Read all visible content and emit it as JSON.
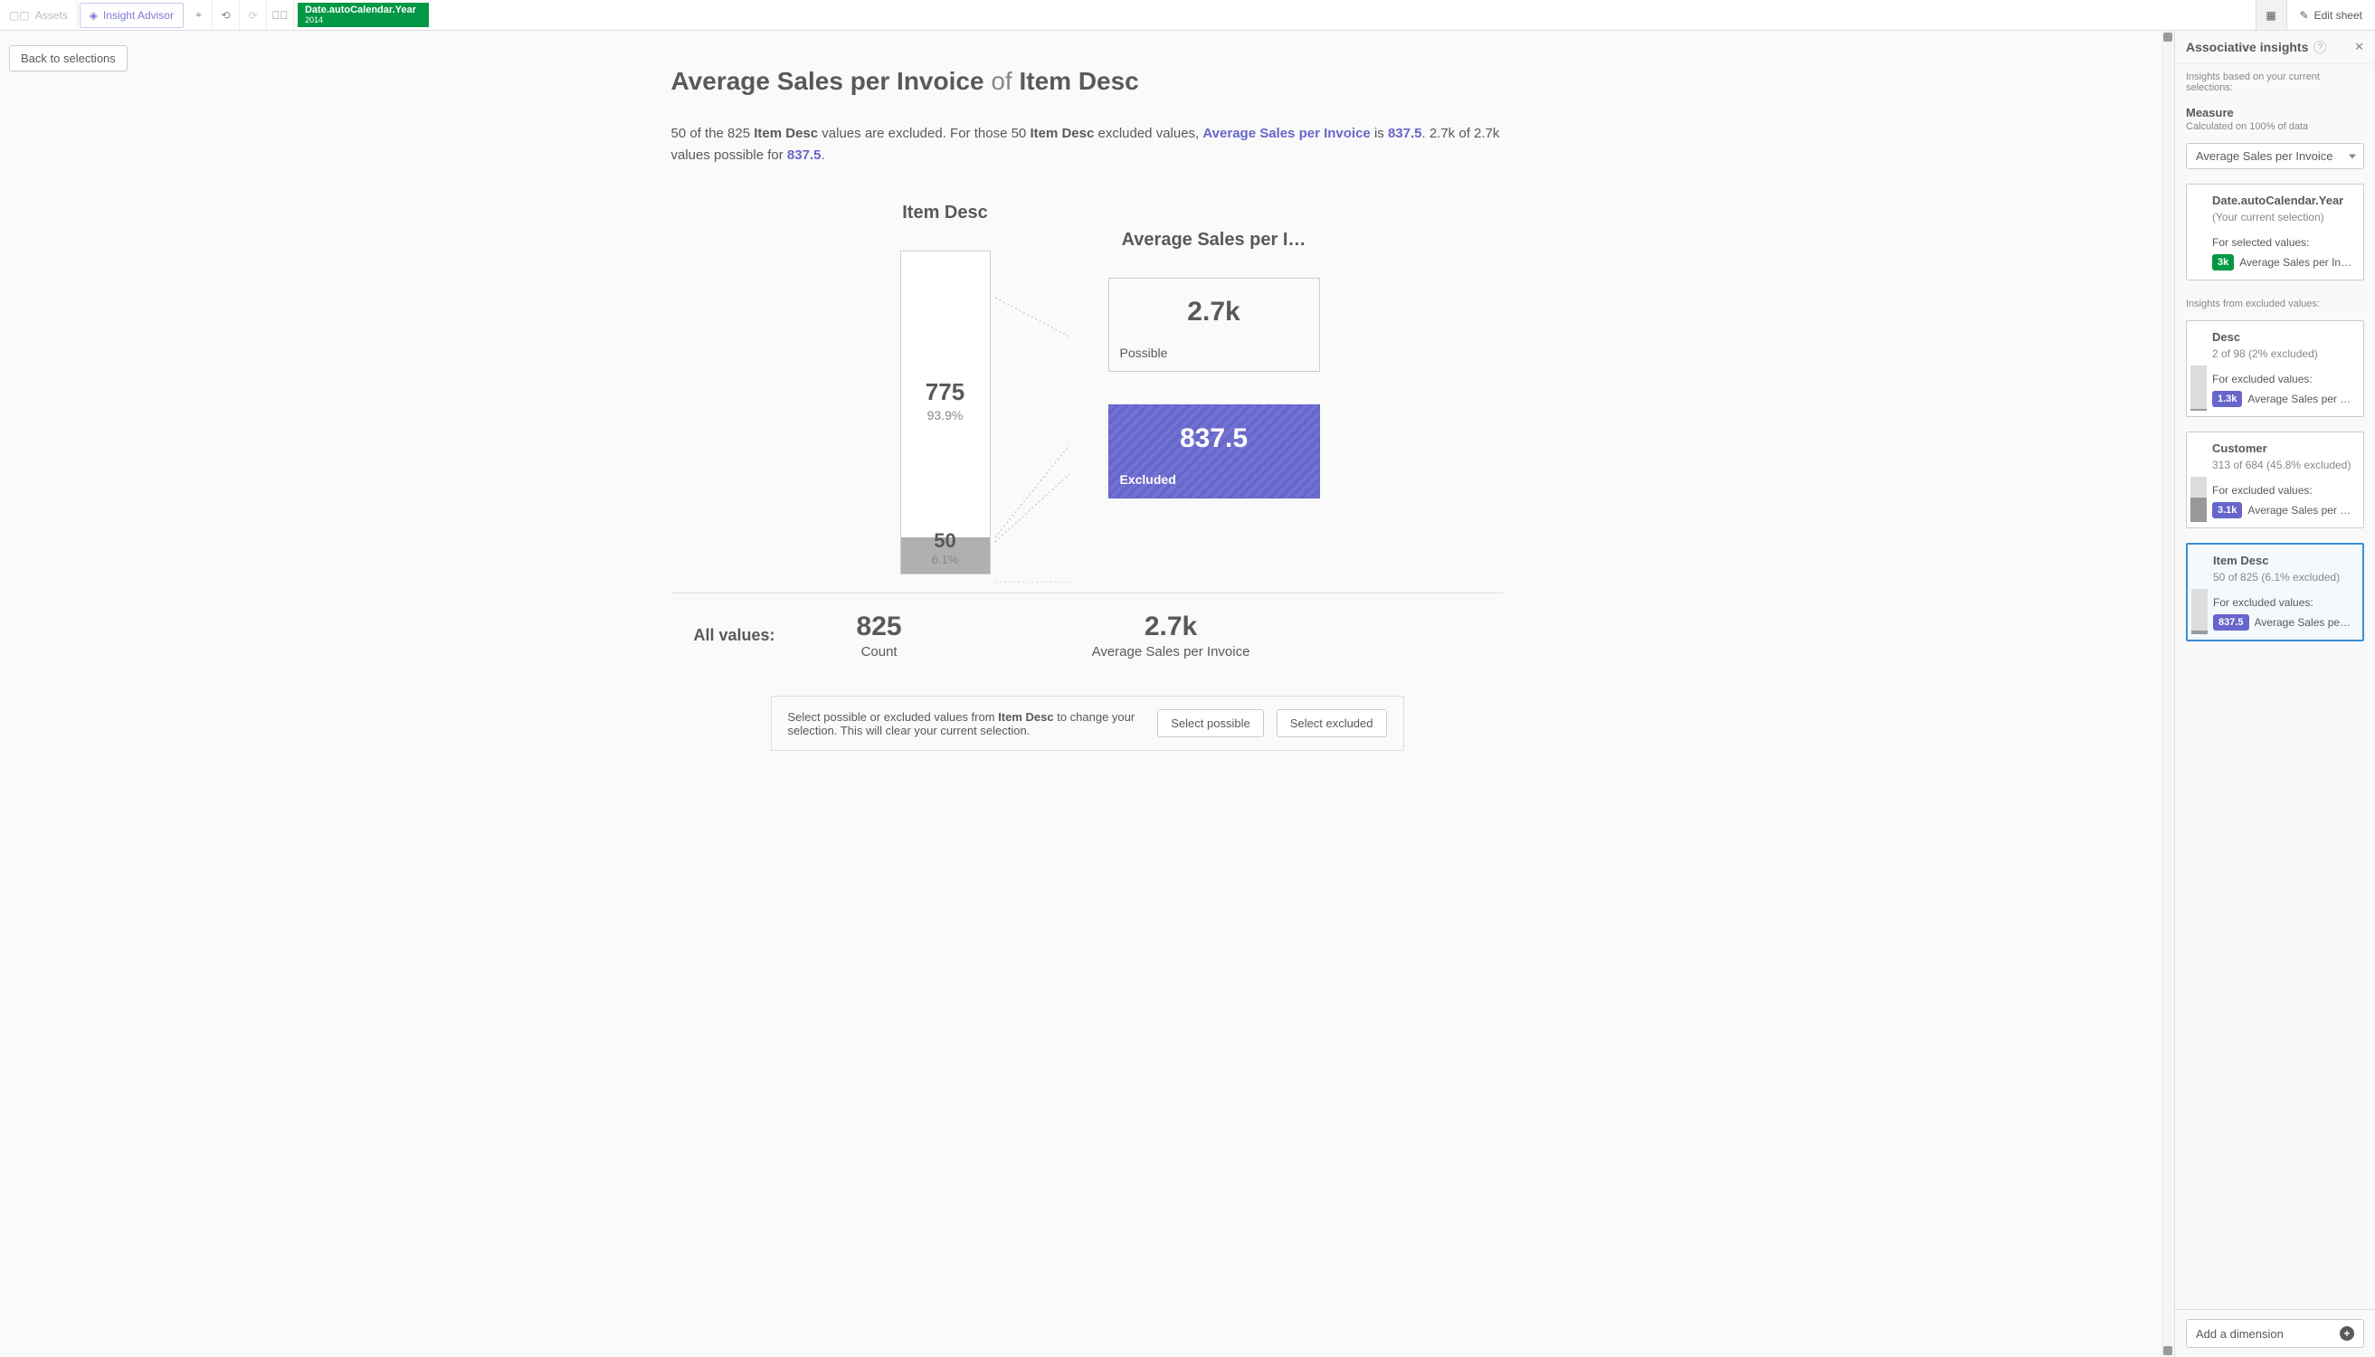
{
  "toolbar": {
    "assets": "Assets",
    "insight_advisor": "Insight Advisor",
    "selection_field": "Date.autoCalendar.Year",
    "selection_value": "2014",
    "edit_sheet": "Edit sheet"
  },
  "back_button": "Back to selections",
  "page_title": {
    "measure": "Average Sales per Invoice",
    "of": " of ",
    "dimension": "Item Desc"
  },
  "description": {
    "p1a": "50 of the 825 ",
    "p1b": "Item Desc",
    "p1c": " values are excluded. For those 50 ",
    "p1d": "Item Desc",
    "p1e": " excluded values, ",
    "link1": "Average Sales per Invoice",
    "p2a": " is ",
    "link2": "837.5",
    "p2b": ". 2.7k of 2.7k values possible for ",
    "link3": "837.5",
    "p2c": "."
  },
  "chart": {
    "col1_title": "Item Desc",
    "col2_title": "Average Sales per I…",
    "included": {
      "count": "775",
      "pct": "93.9%"
    },
    "excluded": {
      "count": "50",
      "pct": "6.1%"
    },
    "kpi_possible": {
      "value": "2.7k",
      "label": "Possible"
    },
    "kpi_excluded": {
      "value": "837.5",
      "label": "Excluded"
    }
  },
  "all_values": {
    "label": "All values:",
    "count_value": "825",
    "count_label": "Count",
    "measure_value": "2.7k",
    "measure_label": "Average Sales per Invoice"
  },
  "action_box": {
    "text_a": "Select possible or excluded values from ",
    "text_bold": "Item Desc",
    "text_b": " to change your selection. This will clear your current selection.",
    "select_possible": "Select possible",
    "select_excluded": "Select excluded"
  },
  "right_panel": {
    "title": "Associative insights",
    "subtitle": "Insights based on your current selections:",
    "measure_label": "Measure",
    "measure_sub": "Calculated on 100% of data",
    "measure_value": "Average Sales per Invoice",
    "current_sel": {
      "title": "Date.autoCalendar.Year",
      "sub": "(Your current selection)",
      "for": "For selected values:",
      "badge": "3k",
      "measure": "Average Sales per In…"
    },
    "excluded_header": "Insights from excluded values:",
    "cards": [
      {
        "title": "Desc",
        "meta": "2 of 98 (2% excluded)",
        "for": "For excluded values:",
        "badge": "1.3k",
        "measure": "Average Sales per …"
      },
      {
        "title": "Customer",
        "meta": "313 of 684 (45.8% excluded)",
        "for": "For excluded values:",
        "badge": "3.1k",
        "measure": "Average Sales per …"
      },
      {
        "title": "Item Desc",
        "meta": "50 of 825 (6.1% excluded)",
        "for": "For excluded values:",
        "badge": "837.5",
        "measure": "Average Sales pe…"
      }
    ],
    "add_dimension": "Add a dimension"
  },
  "chart_data": {
    "type": "bar",
    "title": "Average Sales per Invoice of Item Desc",
    "dimension": "Item Desc",
    "measure": "Average Sales per Invoice",
    "breakdown": {
      "categories": [
        "Included (Possible)",
        "Excluded"
      ],
      "counts": [
        775,
        50
      ],
      "percentages": [
        93.9,
        6.1
      ],
      "measure_values": [
        2700,
        837.5
      ]
    },
    "totals": {
      "count": 825,
      "measure_value": 2700
    },
    "selection": {
      "field": "Date.autoCalendar.Year",
      "value": 2014
    }
  }
}
